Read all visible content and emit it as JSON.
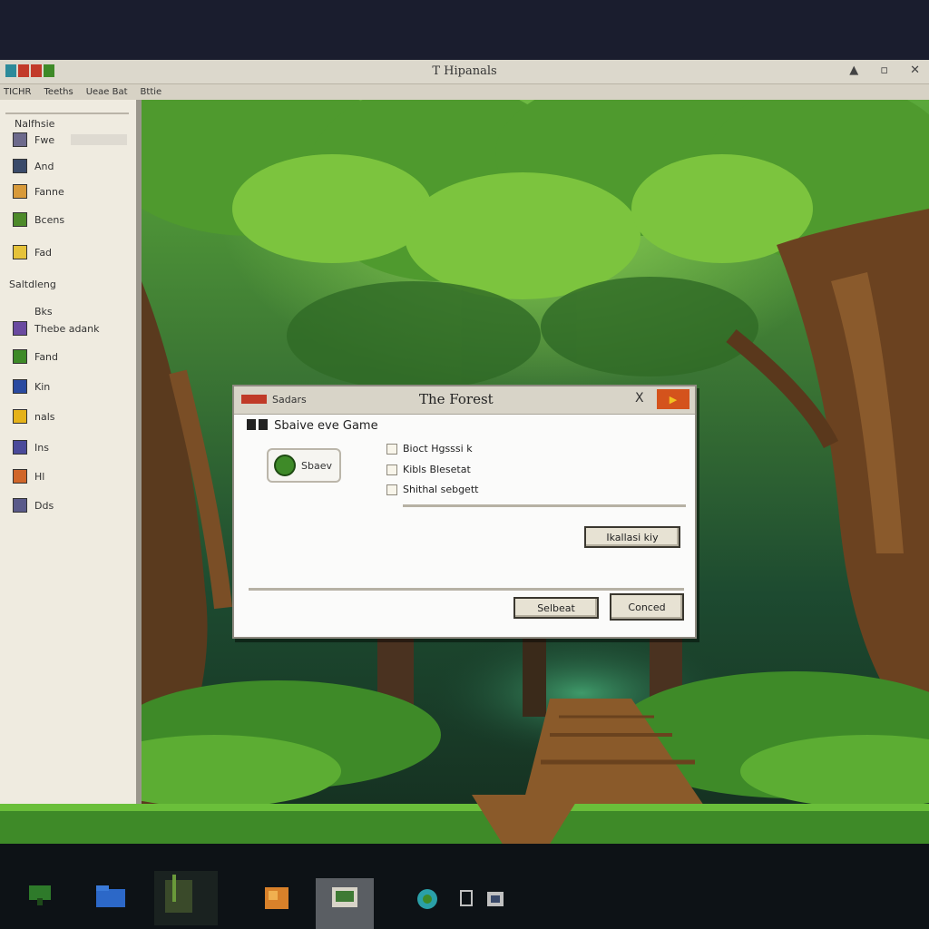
{
  "window": {
    "title": "T Hipanals",
    "minimize": "▲",
    "maximize": "▫",
    "close": "✕"
  },
  "menu": [
    "TICHR",
    "Teeths",
    "Ueae Bat",
    "Bttie"
  ],
  "sidebar": {
    "header": "Nalfhsie",
    "items": [
      {
        "label": "Fwe",
        "icon": "folder-icon",
        "color": "#6d6a8c"
      },
      {
        "label": "And",
        "icon": "game-icon",
        "color": "#3a4a6a"
      },
      {
        "label": "Fanne",
        "icon": "brush-icon",
        "color": "#d89a3a"
      },
      {
        "label": "Bcens",
        "icon": "sword-icon",
        "color": "#4d8a2a"
      },
      {
        "label": "Fad",
        "icon": "note-icon",
        "color": "#e5c23a"
      }
    ],
    "section": "Saltdleng",
    "section_items": [
      {
        "label": "Bks",
        "icon": "book-icon",
        "color": "#4a4a8a"
      },
      {
        "label": "Thebe adank",
        "icon": "map-icon",
        "color": "#6a4aa0"
      },
      {
        "label": "Fand",
        "icon": "leaf-icon",
        "color": "#3e8a28"
      },
      {
        "label": "Kin",
        "icon": "monitor-icon",
        "color": "#2a4aa0"
      },
      {
        "label": "nals",
        "icon": "trophy-icon",
        "color": "#e5b21a"
      },
      {
        "label": "Ins",
        "icon": "chat-icon",
        "color": "#4a4a9a"
      },
      {
        "label": "Hl",
        "icon": "shield-icon",
        "color": "#d0662a"
      },
      {
        "label": "Dds",
        "icon": "settings-icon",
        "color": "#5a5a8a"
      }
    ]
  },
  "dialog": {
    "app_label": "Sadars",
    "title": "The Forest",
    "close": "X",
    "heading": "Sbaive eve Game",
    "save_button": "Sbaev",
    "options": [
      "Bioct Hgsssi k",
      "Kibls Blesetat",
      "Shithal sebgett"
    ],
    "action_button": "Ikallasi kiy",
    "select_button": "Selbeat",
    "cancel_button": "Conced"
  },
  "taskbar": {
    "items": [
      {
        "name": "tree-app-icon",
        "color": "#2e7a2a"
      },
      {
        "name": "folder-app-icon",
        "color": "#2c68c8"
      },
      {
        "name": "terminal-app-icon",
        "color": "#3a4a2a"
      },
      {
        "name": "photo-app-icon",
        "color": "#d8812a"
      },
      {
        "name": "game-window-app-icon",
        "color": "#5a5e63"
      },
      {
        "name": "globe-app-icon",
        "color": "#2aa0a8"
      },
      {
        "name": "chat-app-icon",
        "color": "#c0c0c0"
      },
      {
        "name": "store-app-icon",
        "color": "#c0c0c0"
      }
    ]
  }
}
